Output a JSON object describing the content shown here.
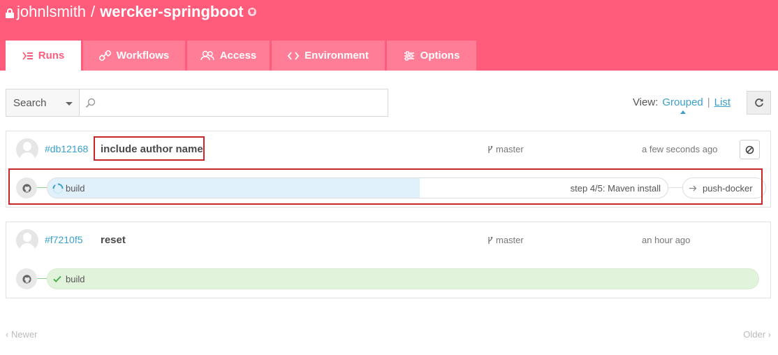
{
  "header": {
    "owner": "johnlsmith",
    "separator": "/",
    "repo": "wercker-springboot",
    "icons": [
      "lock-icon",
      "github-icon"
    ],
    "background": "#ff5c7c"
  },
  "tabs": [
    {
      "label": "Runs",
      "icon": "runs-icon",
      "active": true
    },
    {
      "label": "Workflows",
      "icon": "workflows-icon",
      "active": false
    },
    {
      "label": "Access",
      "icon": "access-icon",
      "active": false
    },
    {
      "label": "Environment",
      "icon": "code-icon",
      "active": false
    },
    {
      "label": "Options",
      "icon": "options-icon",
      "active": false
    }
  ],
  "search": {
    "type_selected": "Search",
    "value": "",
    "placeholder": ""
  },
  "view": {
    "label": "View:",
    "grouped": "Grouped",
    "separator": "|",
    "list": "List",
    "selected": "Grouped"
  },
  "runs": [
    {
      "hash": "#db12168",
      "message": "include author name",
      "branch": "master",
      "time": "a few seconds ago",
      "has_abort": true,
      "pipeline": {
        "step": "build",
        "state": "running",
        "progress": 0.6,
        "status_text": "step 4/5: Maven install",
        "next": "push-docker"
      }
    },
    {
      "hash": "#f7210f5",
      "message": "reset",
      "branch": "master",
      "time": "an hour ago",
      "has_abort": false,
      "pipeline": {
        "step": "build",
        "state": "passed",
        "status_text": "",
        "next": ""
      }
    }
  ],
  "pager": {
    "newer": "‹ Newer",
    "older": "Older ›"
  },
  "colors": {
    "accent": "#ff5c7c",
    "link": "#3aa0c9",
    "running_fill": "#e0f1fb",
    "passed_fill": "#e2f3dc",
    "highlight": "#c62828"
  }
}
